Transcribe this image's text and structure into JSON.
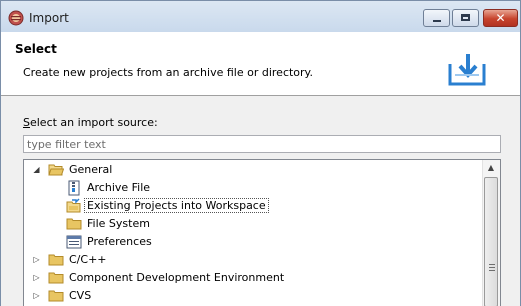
{
  "window": {
    "title": "Import"
  },
  "header": {
    "title": "Select",
    "description": "Create new projects from an archive file or directory."
  },
  "source": {
    "label_accel": "S",
    "label_rest": "elect an import source:",
    "filter_placeholder": "type filter text"
  },
  "tree": {
    "items": [
      {
        "label": "General",
        "icon": "folder-open-icon",
        "expanded": true,
        "level": 0
      },
      {
        "label": "Archive File",
        "icon": "archive-file-icon",
        "level": 1
      },
      {
        "label": "Existing Projects into Workspace",
        "icon": "existing-projects-icon",
        "level": 1,
        "selected": true
      },
      {
        "label": "File System",
        "icon": "folder-icon",
        "level": 1
      },
      {
        "label": "Preferences",
        "icon": "preferences-icon",
        "level": 1
      },
      {
        "label": "C/C++",
        "icon": "folder-icon",
        "expanded": false,
        "level": 0
      },
      {
        "label": "Component Development Environment",
        "icon": "folder-icon",
        "expanded": false,
        "level": 0
      },
      {
        "label": "CVS",
        "icon": "folder-icon",
        "expanded": false,
        "level": 0
      }
    ]
  },
  "colors": {
    "titlebar": "#dce7f3",
    "close_button": "#c7432d",
    "accent_icon": "#2a7fd0",
    "folder": "#e8c562"
  }
}
